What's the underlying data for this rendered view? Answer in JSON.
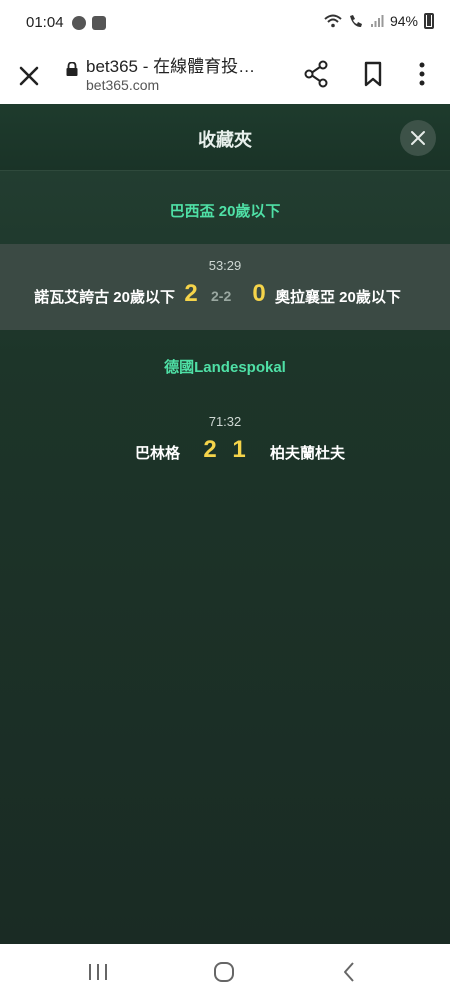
{
  "status_bar": {
    "time": "01:04",
    "battery": "94%"
  },
  "browser": {
    "title": "bet365 - 在線體育投…",
    "url": "bet365.com"
  },
  "panel": {
    "title": "收藏夾",
    "leagues": [
      {
        "name": "巴西盃 20歲以下",
        "match": {
          "time": "53:29",
          "home_team": "諾瓦艾誇古 20歲以下",
          "home_score": "2",
          "aggregate": "2-2",
          "away_score": "0",
          "away_team": "奧拉襄亞 20歲以下"
        }
      },
      {
        "name": "德國Landespokal",
        "match": {
          "time": "71:32",
          "home_team": "巴林格",
          "home_score": "2",
          "away_score": "1",
          "away_team": "柏夫蘭杜夫"
        }
      }
    ]
  },
  "colors": {
    "league": "#4fe0a6",
    "score": "#f5d44a",
    "panel_bg": "#1d3529"
  }
}
